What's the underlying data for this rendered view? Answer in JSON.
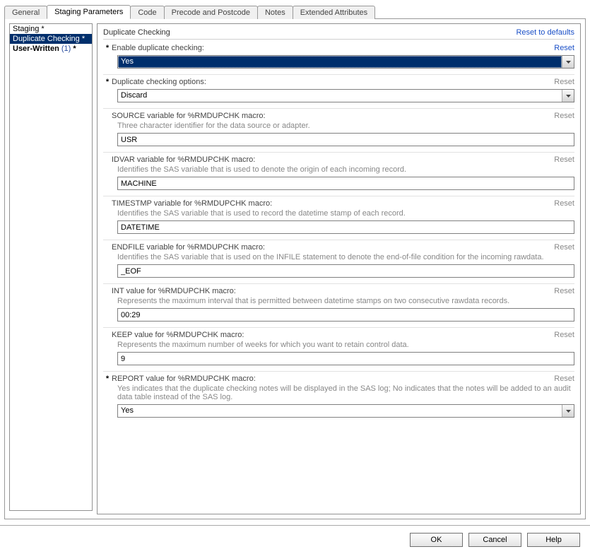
{
  "tabs": {
    "items": [
      "General",
      "Staging Parameters",
      "Code",
      "Precode and Postcode",
      "Notes",
      "Extended Attributes"
    ],
    "activeIndex": 1
  },
  "side": {
    "items": [
      {
        "label": "Staging *",
        "count": ""
      },
      {
        "label": "Duplicate Checking *",
        "count": ""
      },
      {
        "label": "User-Written",
        "count": "(1)",
        "suffix": " *"
      }
    ],
    "selectedIndex": 1
  },
  "main": {
    "title": "Duplicate Checking",
    "reset_defaults": "Reset to defaults",
    "reset": "Reset",
    "fields": [
      {
        "required": true,
        "label": "Enable duplicate checking:",
        "desc": "",
        "type": "select",
        "value": "Yes",
        "highlighted": true,
        "resetActive": true
      },
      {
        "required": true,
        "label": "Duplicate checking options:",
        "desc": "",
        "type": "select",
        "value": "Discard",
        "highlighted": false,
        "resetActive": false
      },
      {
        "required": false,
        "label": "SOURCE variable for %RMDUPCHK macro:",
        "desc": "Three character identifier for the data source or adapter.",
        "type": "text",
        "value": "USR",
        "resetActive": false
      },
      {
        "required": false,
        "label": "IDVAR variable for %RMDUPCHK macro:",
        "desc": "Identifies the SAS variable that is used to denote the origin of each incoming record.",
        "type": "text",
        "value": "MACHINE",
        "resetActive": false
      },
      {
        "required": false,
        "label": "TIMESTMP variable for %RMDUPCHK macro:",
        "desc": "Identifies the SAS variable that is used to record the datetime stamp of each record.",
        "type": "text",
        "value": "DATETIME",
        "resetActive": false
      },
      {
        "required": false,
        "label": "ENDFILE variable for %RMDUPCHK macro:",
        "desc": "Identifies the SAS variable that is used on the INFILE statement to denote the end-of-file condition for the incoming rawdata.",
        "type": "text",
        "value": "_EOF",
        "resetActive": false
      },
      {
        "required": false,
        "label": "INT value for %RMDUPCHK macro:",
        "desc": "Represents the maximum interval that is permitted between datetime stamps on two consecutive rawdata records.",
        "type": "text",
        "value": "00:29",
        "resetActive": false
      },
      {
        "required": false,
        "label": "KEEP value for %RMDUPCHK macro:",
        "desc": "Represents the maximum number of weeks for which you want to retain control data.",
        "type": "text",
        "value": "9",
        "resetActive": false
      },
      {
        "required": true,
        "label": "REPORT value for %RMDUPCHK macro:",
        "desc": "Yes indicates that the duplicate checking notes will be displayed in the SAS log; No indicates that the notes will be added to an audit data table instead of the SAS log.",
        "type": "select",
        "value": "Yes",
        "highlighted": false,
        "resetActive": false
      }
    ]
  },
  "buttons": {
    "ok": "OK",
    "cancel": "Cancel",
    "help": "Help"
  }
}
